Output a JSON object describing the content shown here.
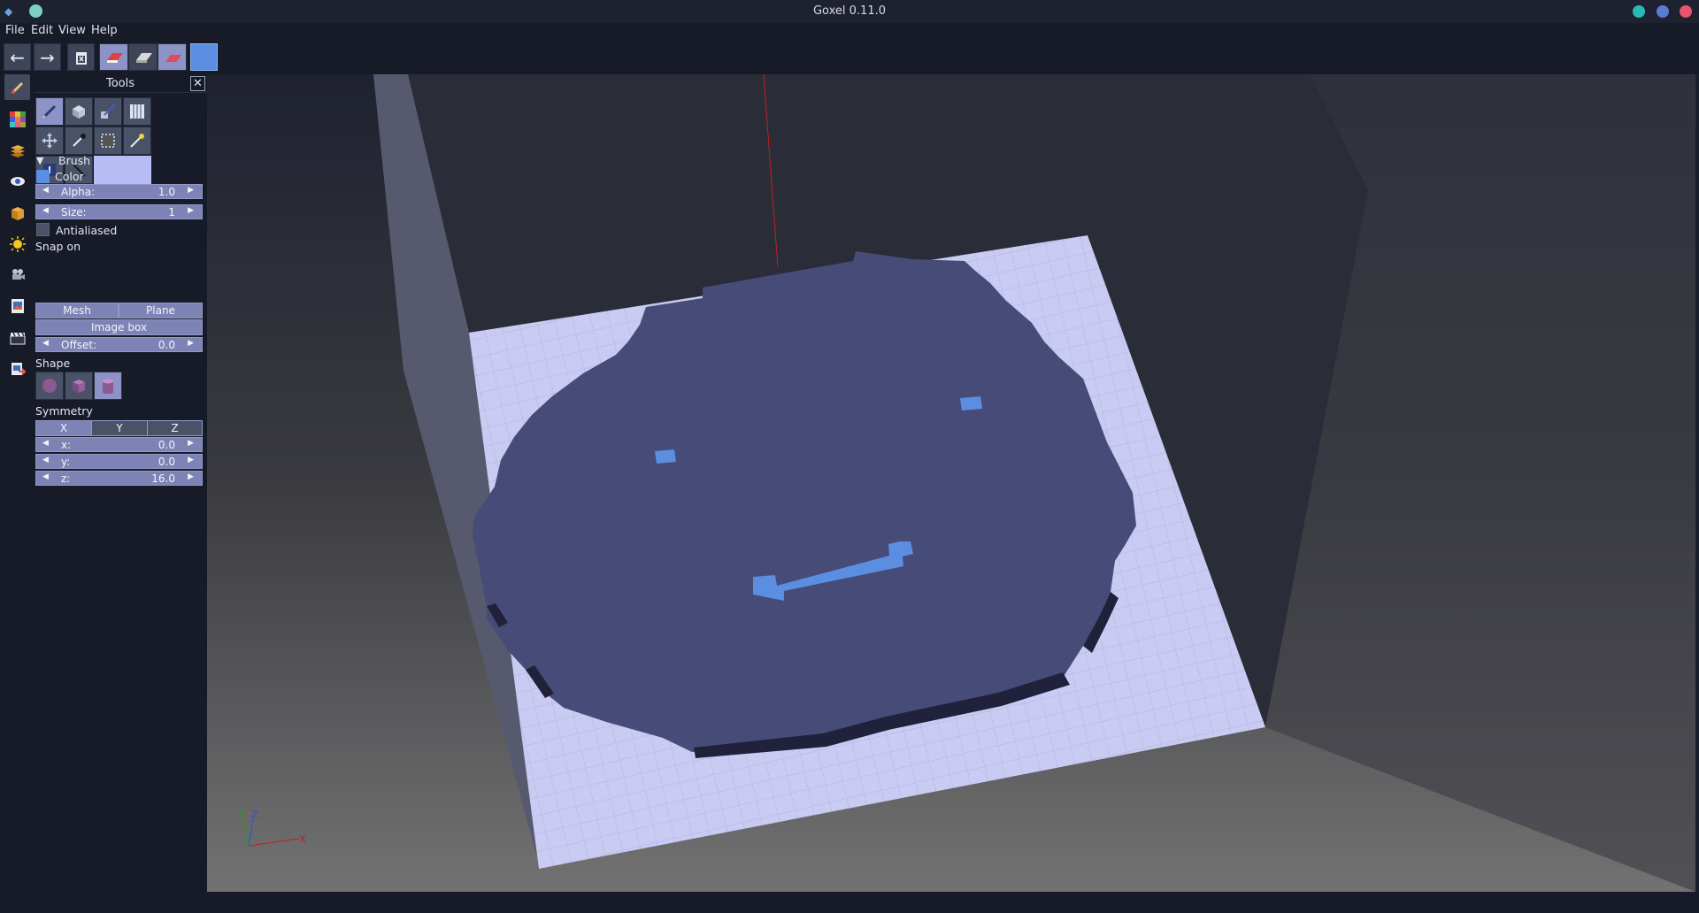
{
  "window": {
    "title": "Goxel 0.11.0"
  },
  "colors": {
    "accent": "#5b8ee0",
    "panel_bg": "#171b28",
    "selected_button": "#8d93c6",
    "voxel_body": "#474b78",
    "voxel_grid": "#c9cbf2",
    "close": "#e8536f",
    "maximize": "#5a7bd4",
    "minimize": "#2bb8b8"
  },
  "menu": {
    "file": "File",
    "edit": "Edit",
    "view": "View",
    "help": "Help"
  },
  "toolbar": {
    "icons": [
      "undo-arrow",
      "redo-arrow",
      "trash-clear",
      "paint-mode-add",
      "paint-mode-sub",
      "paint-mode-paint",
      "current-color"
    ],
    "current_color": "#5b8ee0"
  },
  "sidebar": {
    "icons": [
      "tools",
      "palette",
      "layers",
      "view",
      "cube",
      "light",
      "camera",
      "image",
      "animation",
      "export"
    ]
  },
  "tools_panel": {
    "title": "Tools",
    "close_label": "✕",
    "tools": [
      "brush",
      "shape",
      "laser",
      "plane",
      "move",
      "pick-color",
      "selection",
      "magic-wand",
      "extrude",
      "line"
    ],
    "brush": {
      "section": "Brush",
      "color_label": "Color",
      "alpha_label": "Alpha:",
      "alpha_value": "1.0",
      "size_label": "Size:",
      "size_value": "1",
      "antialiased_label": "Antialiased"
    },
    "snap": {
      "section": "Snap on",
      "mesh": "Mesh",
      "plane": "Plane",
      "image_box": "Image box",
      "offset_label": "Offset:",
      "offset_value": "0.0"
    },
    "shape": {
      "section": "Shape",
      "options": [
        "sphere",
        "cube",
        "cylinder"
      ],
      "selected": "cylinder"
    },
    "symmetry": {
      "section": "Symmetry",
      "x": "X",
      "y": "Y",
      "z": "Z",
      "x_label": "x:",
      "x_value": "0.0",
      "y_label": "y:",
      "y_value": "0.0",
      "z_label": "z:",
      "z_value": "16.0"
    }
  },
  "viewport": {
    "axis_labels": {
      "x": "X",
      "y": "Y",
      "z": "Z"
    }
  }
}
